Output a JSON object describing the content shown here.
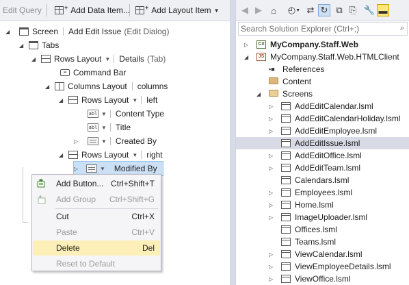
{
  "designer": {
    "toolbar": {
      "edit_query": "Edit Query",
      "add_data_item": "Add Data Item...",
      "add_layout_item": "Add Layout Item"
    },
    "tree": {
      "screen": {
        "label": "Screen",
        "name": "Add Edit Issue",
        "type": "(Edit Dialog)"
      },
      "tabs": {
        "label": "Tabs"
      },
      "rows_details": {
        "label": "Rows Layout",
        "name": "Details",
        "type": "(Tab)"
      },
      "command_bar": {
        "label": "Command Bar"
      },
      "columns": {
        "label": "Columns Layout",
        "name": "columns"
      },
      "rows_left": {
        "label": "Rows Layout",
        "name": "left"
      },
      "content_type": {
        "label": "Content Type"
      },
      "title": {
        "label": "Title"
      },
      "created_by": {
        "label": "Created By"
      },
      "rows_right": {
        "label": "Rows Layout",
        "name": "right"
      },
      "modified_by": {
        "label": "Modified By"
      }
    },
    "context_menu": [
      {
        "label": "Add Button...",
        "shortcut": "Ctrl+Shift+T",
        "enabled": true,
        "icon": "add-button-icon"
      },
      {
        "label": "Add Group",
        "shortcut": "Ctrl+Shift+G",
        "enabled": false,
        "icon": "add-group-icon"
      },
      {
        "label": "Cut",
        "shortcut": "Ctrl+X",
        "enabled": true
      },
      {
        "label": "Paste",
        "shortcut": "Ctrl+V",
        "enabled": false
      },
      {
        "label": "Delete",
        "shortcut": "Del",
        "enabled": true,
        "highlighted": true
      },
      {
        "label": "Reset to Default",
        "shortcut": "",
        "enabled": false
      }
    ]
  },
  "solution_explorer": {
    "search_placeholder": "Search Solution Explorer (Ctrl+;)",
    "items": [
      {
        "label": "MyCompany.Staff.Web",
        "icon": "csharp-project-icon",
        "bold": true
      },
      {
        "label": "MyCompany.Staff.Web.HTMLClient",
        "icon": "js-project-icon"
      },
      {
        "label": "References",
        "icon": "references-icon"
      },
      {
        "label": "Content",
        "icon": "folder-icon"
      },
      {
        "label": "Screens",
        "icon": "open-folder-icon"
      },
      {
        "label": "AddEditCalendar.lsml",
        "icon": "lsml-file-icon"
      },
      {
        "label": "AddEditCalendarHoliday.lsml",
        "icon": "lsml-file-icon"
      },
      {
        "label": "AddEditEmployee.lsml",
        "icon": "lsml-file-icon"
      },
      {
        "label": "AddEditIssue.lsml",
        "icon": "lsml-file-icon",
        "selected": true
      },
      {
        "label": "AddEditOffice.lsml",
        "icon": "lsml-file-icon"
      },
      {
        "label": "AddEditTeam.lsml",
        "icon": "lsml-file-icon"
      },
      {
        "label": "Calendars.lsml",
        "icon": "lsml-file-icon"
      },
      {
        "label": "Employees.lsml",
        "icon": "lsml-file-icon"
      },
      {
        "label": "Home.lsml",
        "icon": "lsml-file-icon"
      },
      {
        "label": "ImageUploader.lsml",
        "icon": "lsml-file-icon"
      },
      {
        "label": "Offices.lsml",
        "icon": "lsml-file-icon"
      },
      {
        "label": "Teams.lsml",
        "icon": "lsml-file-icon"
      },
      {
        "label": "ViewCalendar.lsml",
        "icon": "lsml-file-icon"
      },
      {
        "label": "ViewEmployeeDetails.lsml",
        "icon": "lsml-file-icon"
      },
      {
        "label": "ViewOffice.lsml",
        "icon": "lsml-file-icon"
      }
    ]
  },
  "colors": {
    "menu_highlight": "#fcf0b8",
    "selected_row": "#d8dbe6",
    "toolbar_bg": "#eef0f3"
  }
}
